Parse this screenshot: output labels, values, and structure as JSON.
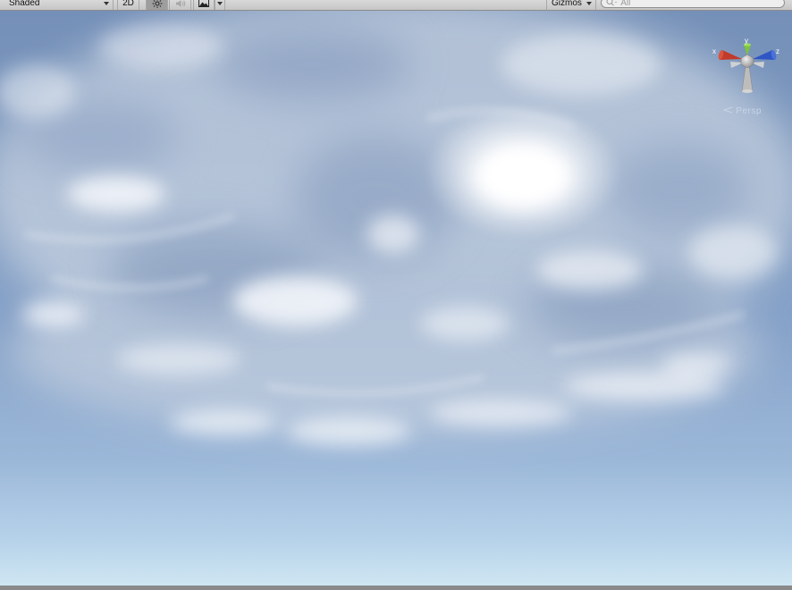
{
  "toolbar": {
    "shading_mode": "Shaded",
    "mode_2d_label": "2D",
    "gizmos_label": "Gizmos",
    "search_placeholder": "All",
    "icons": [
      "sun-icon",
      "audio-icon",
      "image-effects-icon",
      "chevron-down-icon",
      "search-icon"
    ]
  },
  "scene_gizmo": {
    "axis_x": "x",
    "axis_y": "y",
    "axis_z": "z",
    "projection": "Persp",
    "colors": {
      "x_axis": "#c23a2a",
      "y_axis": "#7ec43a",
      "z_axis": "#2f56c4",
      "center": "#bfbfbf"
    }
  },
  "viewport": {
    "sky_colors": [
      "#7590b8",
      "#86a2c8",
      "#cfe6f2"
    ]
  }
}
